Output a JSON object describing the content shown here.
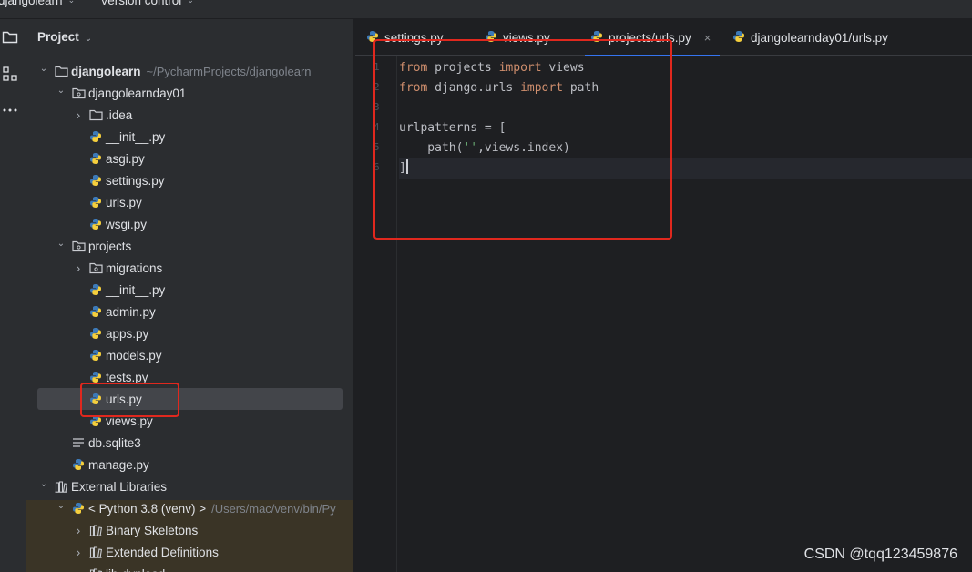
{
  "topbar": {
    "project_menu": "djangolearn",
    "vcs_menu": "Version control"
  },
  "panel": {
    "title": "Project",
    "tree": [
      {
        "label": "djangolearn",
        "path": "~/PycharmProjects/djangolearn",
        "icon": "folder-icon",
        "chevron": "down"
      },
      {
        "label": "djangolearnday01",
        "icon": "package-folder-icon",
        "chevron": "down"
      },
      {
        "label": ".idea",
        "icon": "folder-icon",
        "chevron": "right"
      },
      {
        "label": "__init__.py",
        "icon": "python-file-icon"
      },
      {
        "label": "asgi.py",
        "icon": "python-file-icon"
      },
      {
        "label": "settings.py",
        "icon": "python-file-icon"
      },
      {
        "label": "urls.py",
        "icon": "python-file-icon"
      },
      {
        "label": "wsgi.py",
        "icon": "python-file-icon"
      },
      {
        "label": "projects",
        "icon": "package-folder-icon",
        "chevron": "down"
      },
      {
        "label": "migrations",
        "icon": "package-folder-icon",
        "chevron": "right"
      },
      {
        "label": "__init__.py",
        "icon": "python-file-icon"
      },
      {
        "label": "admin.py",
        "icon": "python-file-icon"
      },
      {
        "label": "apps.py",
        "icon": "python-file-icon"
      },
      {
        "label": "models.py",
        "icon": "python-file-icon"
      },
      {
        "label": "tests.py",
        "icon": "python-file-icon"
      },
      {
        "label": "urls.py",
        "icon": "python-file-icon",
        "selected": true
      },
      {
        "label": "views.py",
        "icon": "python-file-icon"
      },
      {
        "label": "db.sqlite3",
        "icon": "text-file-icon"
      },
      {
        "label": "manage.py",
        "icon": "python-file-icon"
      },
      {
        "label": "External Libraries",
        "icon": "library-icon",
        "chevron": "down"
      },
      {
        "label": "< Python 3.8 (venv) >",
        "path": "/Users/mac/venv/bin/Py",
        "icon": "python-file-icon",
        "chevron": "down"
      },
      {
        "label": "Binary Skeletons",
        "icon": "library-icon",
        "chevron": "right"
      },
      {
        "label": "Extended Definitions",
        "icon": "library-icon",
        "chevron": "right"
      },
      {
        "label": "lib-dynload",
        "icon": "library-icon",
        "chevron": "right"
      }
    ]
  },
  "editor": {
    "tabs": [
      {
        "label": "settings.py"
      },
      {
        "label": "views.py"
      },
      {
        "label": "projects/urls.py",
        "active": true
      },
      {
        "label": "djangolearnday01/urls.py"
      }
    ],
    "close_glyph": "×",
    "line_numbers": [
      "1",
      "2",
      "3",
      "4",
      "5",
      "6"
    ],
    "code": {
      "l1_kw1": "from",
      "l1_mod": " projects ",
      "l1_kw2": "import",
      "l1_name": " views",
      "l2_kw1": "from",
      "l2_mod": " django.urls ",
      "l2_kw2": "import",
      "l2_name": " path",
      "l4_a": "urlpatterns = [",
      "l5_a": "    path(",
      "l5_str": "''",
      "l5_b": ",views.index)",
      "l6_a": "]"
    }
  },
  "watermark": "CSDN @tqq123459876",
  "colors": {
    "accent": "#3574f0",
    "annotation": "#e0281e",
    "keyword": "#cf8e6d",
    "string": "#6aab73"
  }
}
